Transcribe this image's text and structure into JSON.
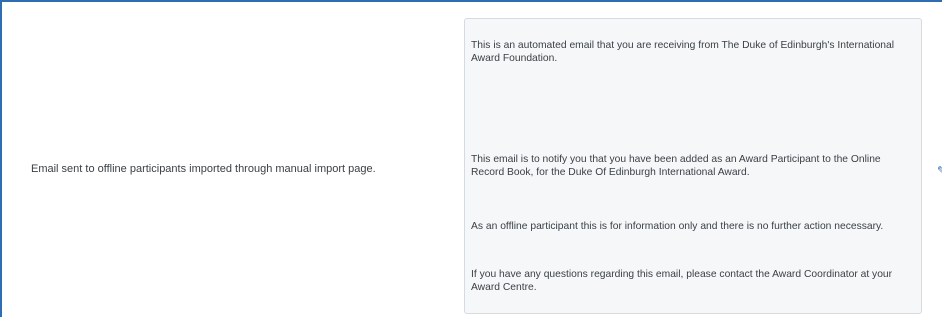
{
  "row": {
    "description": "Email sent to offline participants imported through manual import page."
  },
  "email_preview": {
    "paragraphs": [
      "This is an automated email that you are receiving from The Duke of Edinburgh's International Award Foundation.",
      "This email is to notify you that you have been added as an Award Participant to the Online Record Book, for the Duke Of Edinburgh International Award.",
      "As an offline participant this is for information only and there is no further action necessary.",
      "If you have any questions regarding this email, please contact the Award Coordinator at your Award Centre."
    ]
  },
  "colors": {
    "frame_border": "#2f6db3",
    "preview_background": "#f6f7f9",
    "preview_border": "#d6dbe1",
    "text": "#3a3f44"
  }
}
